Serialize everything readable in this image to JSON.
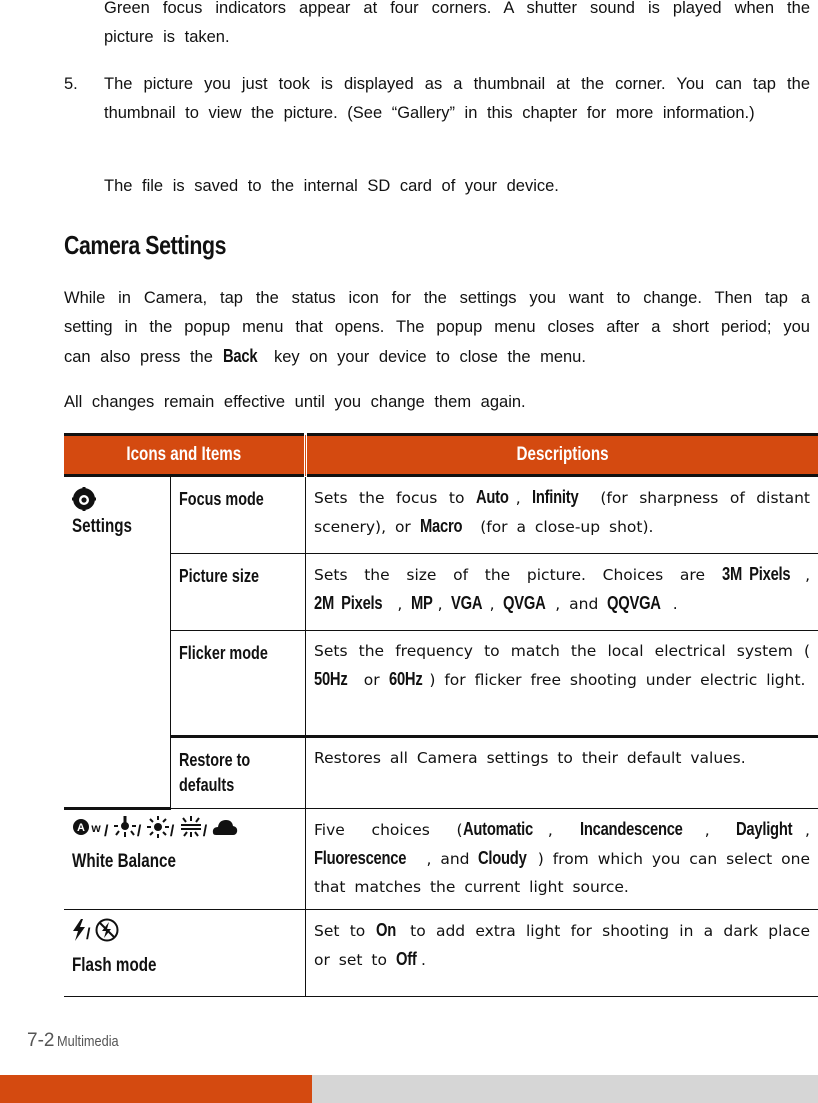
{
  "intro": {
    "line1": "Green focus indicators appear at four corners. A shutter sound is played when the picture is taken.",
    "step5_number": "5.",
    "step5_text": "The picture you just took is displayed as a thumbnail at the corner. You can tap the thumbnail to view the picture. (See “Gallery” in this chapter for more information.)",
    "file_note": "The file is saved to the internal SD card of your device."
  },
  "section": {
    "title": "Camera Settings",
    "para1_a": "While in Camera, tap the status icon for the settings you want to change. Then tap a setting in the popup menu that opens. The popup menu closes after a short period; you can also press the",
    "para1_key": "Back",
    "para1_b": "key on your device to close the menu.",
    "para2": "All changes remain effective until you change them again."
  },
  "table": {
    "headers": [
      "Icons and Items",
      "Descriptions"
    ],
    "settings_group": {
      "icon": "settings-icon",
      "label": "Settings",
      "rows": [
        {
          "item": "Focus mode",
          "desc": [
            {
              "t": "Sets the focus to "
            },
            {
              "b": "Auto"
            },
            {
              "t": ", "
            },
            {
              "b": "Infinity"
            },
            {
              "t": " (for sharpness of distant scenery), or "
            },
            {
              "b": "Macro"
            },
            {
              "t": " (for a close-up shot)."
            }
          ]
        },
        {
          "item": "Picture size",
          "desc": [
            {
              "t": "Sets the size of the picture. Choices are "
            },
            {
              "b": "3M Pixels"
            },
            {
              "t": ", "
            },
            {
              "b": "2M Pixels"
            },
            {
              "t": ", "
            },
            {
              "b": "MP"
            },
            {
              "t": ", "
            },
            {
              "b": "VGA"
            },
            {
              "t": ", "
            },
            {
              "b": "QVGA"
            },
            {
              "t": ", and "
            },
            {
              "b": "QQVGA"
            },
            {
              "t": "."
            }
          ]
        },
        {
          "item": "Flicker mode",
          "desc": [
            {
              "t": "Sets the frequency to match the local electrical system ("
            },
            {
              "b": "50Hz"
            },
            {
              "t": " or "
            },
            {
              "b": "60Hz"
            },
            {
              "t": ") for flicker free shooting under electric light."
            }
          ]
        },
        {
          "item": "Restore to defaults",
          "desc": [
            {
              "t": "Restores all Camera settings to their default values."
            }
          ]
        }
      ]
    },
    "white_balance": {
      "icons": [
        "auto-white-balance-icon",
        "incandescent-icon",
        "daylight-icon",
        "fluorescent-icon",
        "cloudy-icon"
      ],
      "separator": "/",
      "label": "White Balance",
      "desc": [
        {
          "t": "Five choices ("
        },
        {
          "b": "Automatic"
        },
        {
          "t": ", "
        },
        {
          "b": "Incandescence"
        },
        {
          "t": ", "
        },
        {
          "b": "Daylight"
        },
        {
          "t": ", "
        },
        {
          "b": "Fluorescence"
        },
        {
          "t": ", and "
        },
        {
          "b": "Cloudy"
        },
        {
          "t": ") from which you can select one that matches the current light source."
        }
      ]
    },
    "flash": {
      "icons": [
        "flash-on-icon",
        "flash-off-icon"
      ],
      "separator": "/",
      "label": "Flash mode",
      "desc": [
        {
          "t": "Set to "
        },
        {
          "b": "On"
        },
        {
          "t": " to add extra light for shooting in a dark place or set to "
        },
        {
          "b": "Off"
        },
        {
          "t": "."
        }
      ]
    }
  },
  "footer": {
    "page_number": "7-2",
    "section_name": "Multimedia",
    "accent_color": "#d44a10",
    "bar_gray": "#d6d6d6"
  }
}
